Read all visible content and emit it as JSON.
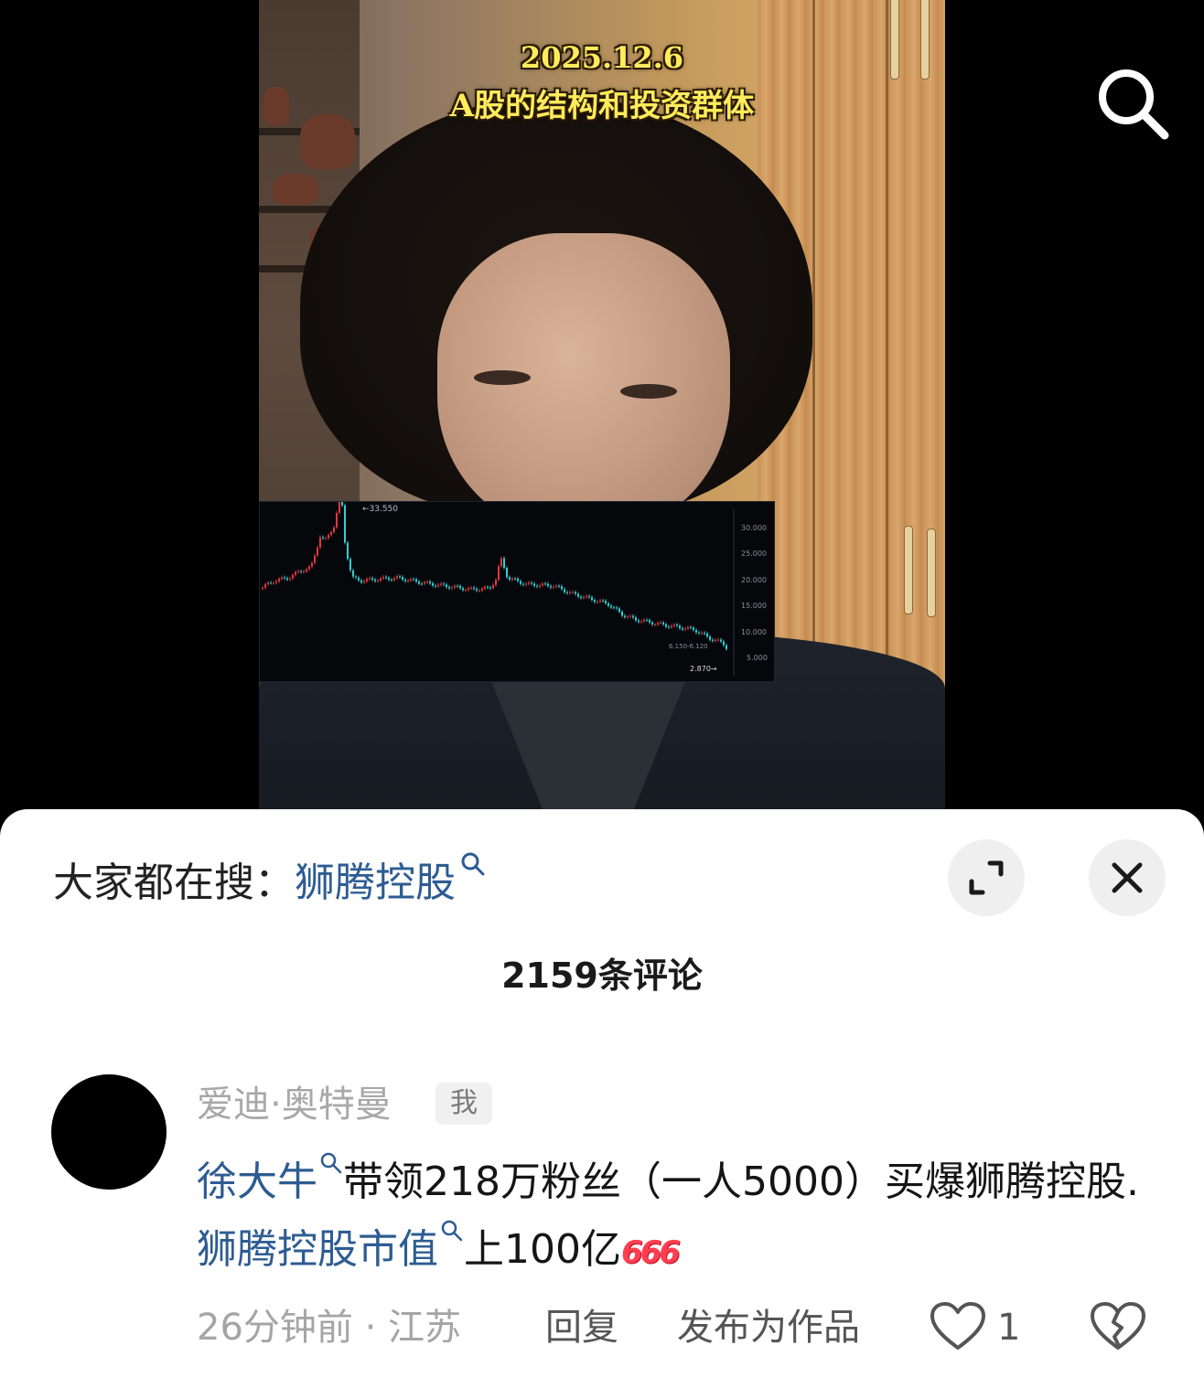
{
  "video": {
    "overlay_date": "2025.12.6",
    "overlay_subtitle": "A股的结构和投资群体",
    "icons": {
      "search": "search-icon"
    },
    "stock_chart": {
      "high_label": "←33.550",
      "y_ticks": [
        "30.000",
        "25.000",
        "20.000",
        "15.000",
        "10.000",
        "5.000"
      ],
      "range_label": "6.150-6.120",
      "low_label": "2.870→",
      "colors": {
        "up": "#e2383f",
        "down": "#2bd2d2",
        "axis_text": "#8a8f99"
      }
    }
  },
  "sheet": {
    "trending_prefix": "大家都在搜：",
    "trending_term": "狮腾控股",
    "icons": {
      "expand": "expand-icon",
      "close": "close-icon"
    },
    "comment_count": "2159条评论",
    "comment": {
      "author": "爱迪·奥特曼",
      "me_badge": "我",
      "link1": "徐大牛",
      "text1": "带领218万粉丝（一人5000）买爆狮腾控股.",
      "link2": "狮腾控股市值",
      "text2": "上100亿",
      "emoji": "666",
      "time_location": "26分钟前 · 江苏",
      "reply_label": "回复",
      "publish_label": "发布为作品",
      "like_count": "1",
      "icons": {
        "like": "heart-outline-icon",
        "dislike": "broken-heart-icon"
      }
    }
  },
  "colors": {
    "link": "#2d5c92",
    "overlay_text": "#ffeb5c"
  }
}
